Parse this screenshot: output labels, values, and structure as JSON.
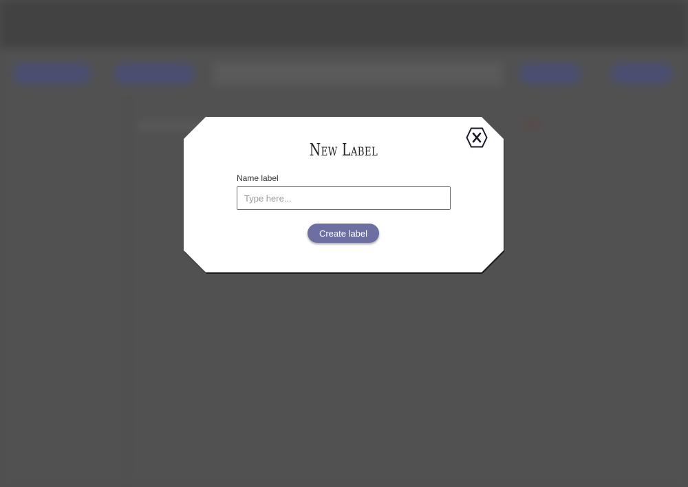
{
  "modal": {
    "title": "New Label",
    "close_icon": "close-hex-icon",
    "field_label": "Name label",
    "input_placeholder": "Type here...",
    "input_value": "",
    "create_button_label": "Create label"
  },
  "colors": {
    "overlay": "#4f4f4f",
    "accent": "#6d6fa3",
    "modal_bg": "#ffffff"
  }
}
